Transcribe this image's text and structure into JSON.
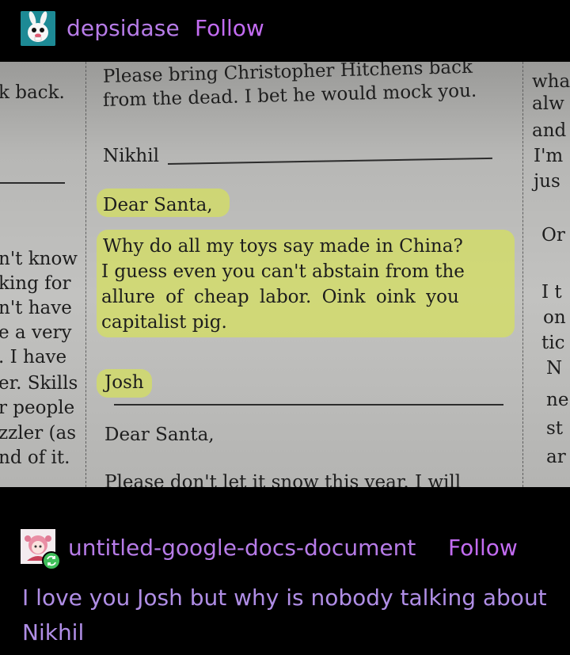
{
  "post": {
    "username": "depsidase",
    "follow_label": "Follow",
    "photo": {
      "left_column": [
        "k  back.",
        "n't know",
        "king for",
        "n't have",
        "e a very",
        ". I have",
        "er. Skills",
        "r people",
        "zzler (as",
        "nd of it."
      ],
      "center_column": {
        "letter1": [
          "Please bring Christopher Hitchens back",
          "from the dead. I bet he would mock you."
        ],
        "signature1": "Nikhil",
        "greeting": "Dear Santa,",
        "letter2": [
          "Why do all my toys say made in China?",
          "I guess even you can't abstain from the",
          "allure of cheap labor. Oink oink you",
          "capitalist pig."
        ],
        "signature2": "Josh",
        "greeting2": "Dear Santa,",
        "next_line": "Please don't let it snow this year. I will"
      },
      "right_column": [
        "wha",
        "alw",
        "and",
        "I'm",
        "jus",
        "Or",
        "I t",
        "on",
        "tic",
        "N",
        "ne",
        "st",
        "ar"
      ]
    }
  },
  "reblog": {
    "username": "untitled-google-docs-document",
    "follow_label": "Follow",
    "comment": "I love you Josh but why is nobody talking about Nikhil"
  },
  "colors": {
    "username": "#b77ce8",
    "follow": "#c36cf2",
    "comment": "#b08ee6",
    "highlight": "#d6e15c",
    "background": "#000000"
  },
  "icons": {
    "avatar1": "cartoon-rabbit-avatar",
    "avatar2": "anime-character-avatar",
    "reblog": "reblog-icon"
  }
}
